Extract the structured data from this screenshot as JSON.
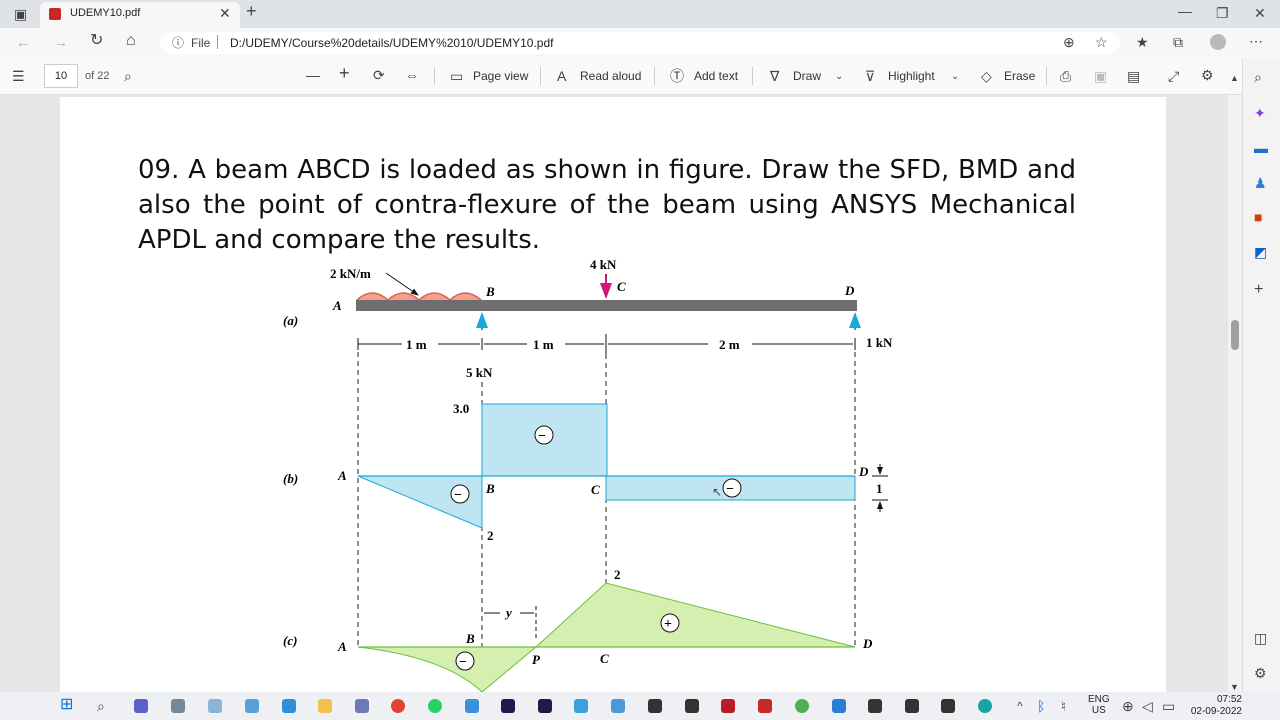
{
  "browser": {
    "tab_title": "UDEMY10.pdf",
    "address_prefix": "File",
    "url": "D:/UDEMY/Course%20details/UDEMY%2010/UDEMY10.pdf"
  },
  "pdf_toolbar": {
    "page_number": "10",
    "page_total": "of 22",
    "page_view": "Page view",
    "read_aloud": "Read aloud",
    "add_text": "Add text",
    "draw": "Draw",
    "highlight": "Highlight",
    "erase": "Erase"
  },
  "document": {
    "question": "09. A beam ABCD is loaded as shown in figure. Draw the SFD, BMD and also the point of contra-flexure of the beam using ANSYS Mechanical APDL and compare the results."
  },
  "figure": {
    "labels": {
      "udl": "2 kN/m",
      "point_load": "4 kN",
      "A": "A",
      "B": "B",
      "C": "C",
      "D": "D",
      "P": "P",
      "reaction_b": "5 kN",
      "reaction_d": "1 kN",
      "dim_ab": "1 m",
      "dim_bc": "1 m",
      "dim_cd": "2 m",
      "part_a": "(a)",
      "part_b": "(b)",
      "part_c": "(c)",
      "sfd_max": "3.0",
      "sfd_min": "2",
      "sfd_cd": "1",
      "bmd_max": "2",
      "bmd_y": "y",
      "minus": "−",
      "plus": "+"
    },
    "colors": {
      "beam": "#6e6e70",
      "load": "#d4147a",
      "support": "#1aa8d6",
      "sfd_fill": "#bfe4f2",
      "bmd_fill": "#d4efb0",
      "udl": "#e05e4e"
    }
  },
  "taskbar": {
    "lang_top": "ENG",
    "lang_bottom": "US",
    "time": "07:52",
    "date": "02-09-2022"
  }
}
